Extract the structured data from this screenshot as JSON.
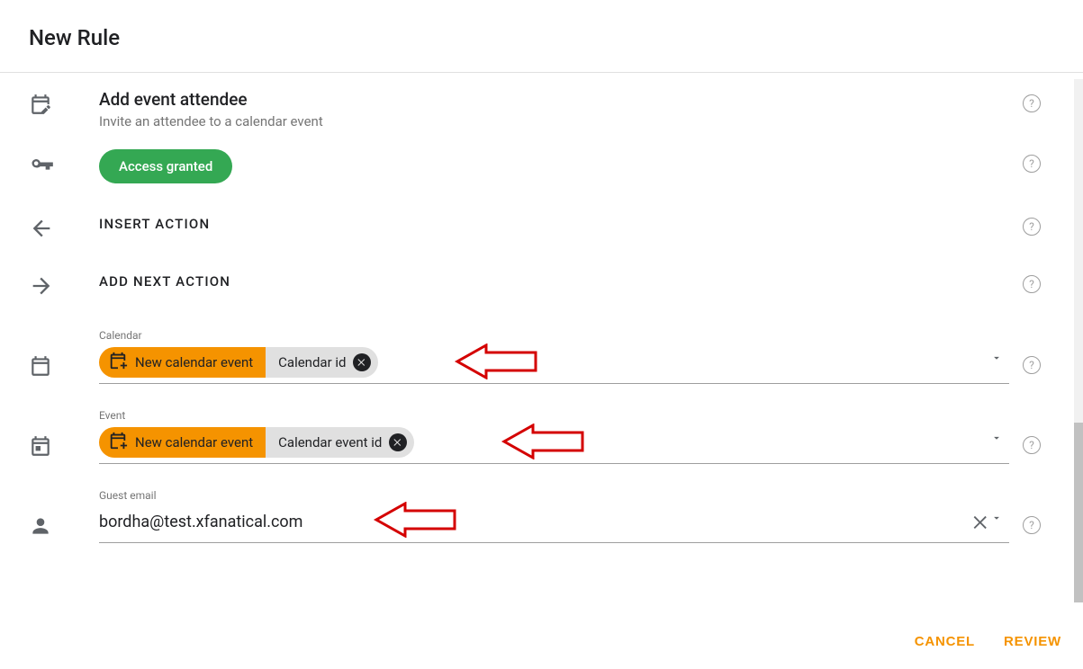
{
  "dialog": {
    "title": "New Rule"
  },
  "header": {
    "title": "Add event attendee",
    "subtitle": "Invite an attendee to a calendar event"
  },
  "access": {
    "label": "Access granted"
  },
  "insert": {
    "label": "INSERT ACTION"
  },
  "next": {
    "label": "ADD NEXT ACTION"
  },
  "fields": {
    "calendar": {
      "label": "Calendar",
      "chip_source": "New calendar event",
      "chip_value": "Calendar id"
    },
    "event": {
      "label": "Event",
      "chip_source": "New calendar event",
      "chip_value": "Calendar event id"
    },
    "guest": {
      "label": "Guest email",
      "value": "bordha@test.xfanatical.com"
    }
  },
  "actions": {
    "cancel": "CANCEL",
    "review": "REVIEW"
  }
}
